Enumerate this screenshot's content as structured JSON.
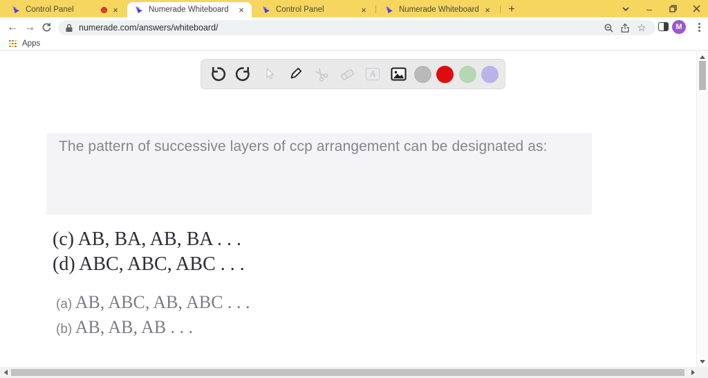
{
  "window": {
    "tabs": [
      {
        "title": "Control Panel",
        "recording": true
      },
      {
        "title": "Numerade Whiteboard",
        "active": true
      },
      {
        "title": "Control Panel"
      },
      {
        "title": "Numerade Whiteboard"
      }
    ],
    "close_glyph": "×",
    "new_tab_glyph": "+",
    "minimize_glyph": "–",
    "theme": {
      "tab_bar": "#f6d65f",
      "active_tab": "#ffffff"
    }
  },
  "nav": {
    "back_glyph": "←",
    "forward_glyph": "→",
    "url": "numerade.com/answers/whiteboard/",
    "star_glyph": "☆",
    "avatar_letter": "M",
    "avatar_color": "#9a57cf"
  },
  "bookmarks": {
    "apps_label": "Apps"
  },
  "toolbar": {
    "tools": [
      "undo",
      "redo",
      "cursor",
      "pen",
      "scissors",
      "eraser",
      "text",
      "image"
    ],
    "text_tool_glyph": "A",
    "colors": [
      {
        "name": "gray",
        "hex": "#b9b9ba"
      },
      {
        "name": "red",
        "hex": "#e10a10"
      },
      {
        "name": "green",
        "hex": "#b4d8b2"
      },
      {
        "name": "purple",
        "hex": "#b8b4e8"
      }
    ]
  },
  "question": {
    "prompt": "The pattern of successive layers of ccp arrangement can be designated as:",
    "options": [
      {
        "label": "(a)",
        "text": "AB, ABC, AB, ABC . . ."
      },
      {
        "label": "(b)",
        "text": "AB, AB, AB . . ."
      },
      {
        "label": "(c)",
        "text": "AB, BA, AB, BA . . ."
      },
      {
        "label": "(d)",
        "text": "ABC, ABC, ABC . . ."
      }
    ]
  }
}
